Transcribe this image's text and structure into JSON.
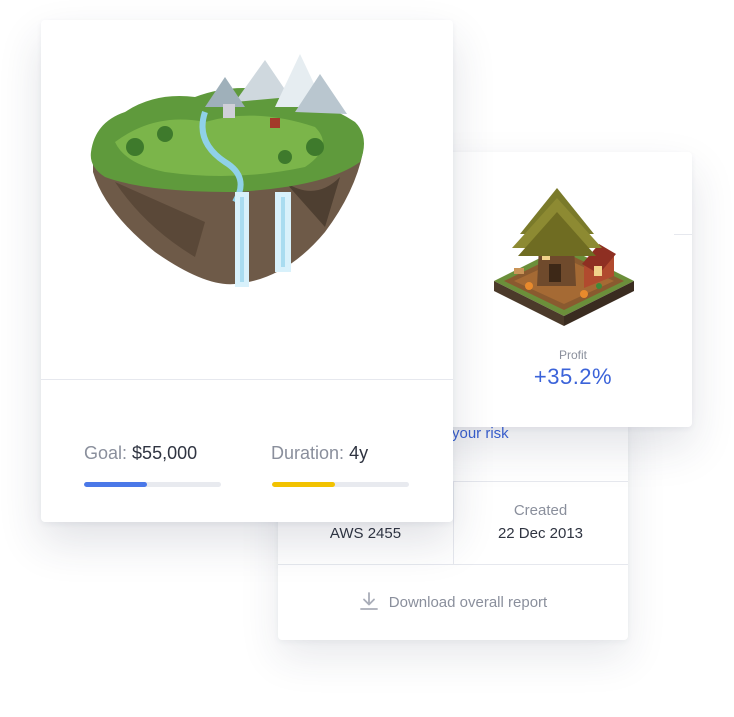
{
  "main_card": {
    "goal_label": "Goal:",
    "goal_value": "$55,000",
    "goal_progress": 0.46,
    "duration_label": "Duration:",
    "duration_value": "4y",
    "duration_progress": 0.46
  },
  "profit_card": {
    "label": "Profit",
    "value": "+35.2%"
  },
  "detail_card": {
    "risk_link": "your risk",
    "left_value": "AWS 2455",
    "created_label": "Created",
    "created_value": "22 Dec 2013",
    "download_label": "Download overall report"
  },
  "colors": {
    "accent_blue": "#3b63d9",
    "goal_bar": "#4a78e8",
    "duration_bar": "#f2c200",
    "muted_text": "#8a8f9c"
  }
}
